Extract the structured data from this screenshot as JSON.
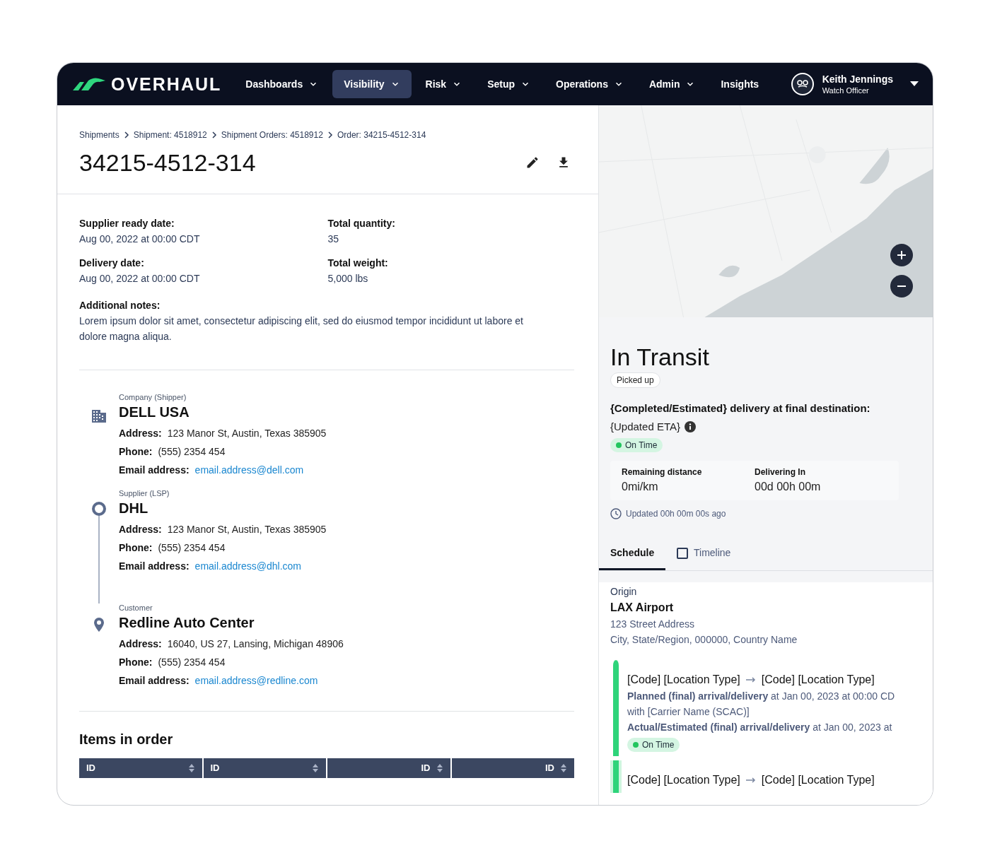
{
  "nav": {
    "logo": "OVERHAUL",
    "items": [
      {
        "label": "Dashboards",
        "selected": false,
        "dropdown": true
      },
      {
        "label": "Visibility",
        "selected": true,
        "dropdown": true
      },
      {
        "label": "Risk",
        "selected": false,
        "dropdown": true
      },
      {
        "label": "Setup",
        "selected": false,
        "dropdown": true
      },
      {
        "label": "Operations",
        "selected": false,
        "dropdown": true
      },
      {
        "label": "Admin",
        "selected": false,
        "dropdown": true
      },
      {
        "label": "Insights",
        "selected": false,
        "dropdown": false
      }
    ],
    "user": {
      "name": "Keith Jennings",
      "role": "Watch Officer"
    }
  },
  "breadcrumbs": [
    "Shipments",
    "Shipment: 4518912",
    "Shipment Orders: 4518912",
    "Order: 34215-4512-314"
  ],
  "title": "34215-4512-314",
  "fields": [
    {
      "label": "Supplier ready date:",
      "value": "Aug 00, 2022 at 00:00 CDT"
    },
    {
      "label": "Total quantity:",
      "value": "35"
    },
    {
      "label": "Delivery date:",
      "value": "Aug 00, 2022 at 00:00 CDT"
    },
    {
      "label": "Total weight:",
      "value": "5,000 lbs"
    }
  ],
  "notes": {
    "label": "Additional notes:",
    "text": "Lorem ipsum dolor sit amet, consectetur adipiscing elit, sed do eiusmod tempor incididunt ut labore et dolore magna aliqua."
  },
  "parties": [
    {
      "kind": "company",
      "category": "Company (Shipper)",
      "name": "DELL USA",
      "rows": [
        {
          "label": "Address:",
          "value": "123 Manor St, Austin, Texas 385905",
          "kind": "text"
        },
        {
          "label": "Phone:",
          "value": "(555) 2354 454",
          "kind": "text"
        },
        {
          "label": "Email address:",
          "value": "email.address@dell.com",
          "kind": "link"
        }
      ]
    },
    {
      "kind": "origin",
      "category": "Supplier (LSP)",
      "name": "DHL",
      "rows": [
        {
          "label": "Address:",
          "value": "123 Manor St, Austin, Texas 385905",
          "kind": "text"
        },
        {
          "label": "Phone:",
          "value": "(555) 2354 454",
          "kind": "text"
        },
        {
          "label": "Email address:",
          "value": "email.address@dhl.com",
          "kind": "link"
        }
      ]
    },
    {
      "kind": "destination",
      "category": "Customer",
      "name": "Redline Auto Center",
      "rows": [
        {
          "label": "Address:",
          "value": "16040, US 27, Lansing, Michigan 48906",
          "kind": "text"
        },
        {
          "label": "Phone:",
          "value": "(555) 2354 454",
          "kind": "text"
        },
        {
          "label": "Email address:",
          "value": "email.address@redline.com",
          "kind": "link"
        }
      ]
    }
  ],
  "items": {
    "title": "Items in order",
    "columns": [
      {
        "label": "ID"
      },
      {
        "label": "ID"
      },
      {
        "label": "ID"
      },
      {
        "label": "ID"
      }
    ]
  },
  "status": {
    "title": "In Transit",
    "badge": "Picked up",
    "eta_label": "{Completed/Estimated} delivery at final destination:",
    "eta_value": "{Updated ETA}",
    "state": {
      "label": "On Time",
      "color": "#22c55e"
    },
    "metrics": [
      {
        "label": "Remaining distance",
        "value": "0mi/km"
      },
      {
        "label": "Delivering In",
        "value": "00d 00h 00m"
      }
    ],
    "updated": "Updated 00h 00m 00s ago"
  },
  "tabs": [
    {
      "label": "Schedule",
      "selected": true
    },
    {
      "label": "Timeline",
      "selected": false
    }
  ],
  "origin": {
    "label": "Origin",
    "name": "LAX Airport",
    "lines": [
      "123 Street Address",
      "City, State/Region, 000000, Country Name"
    ]
  },
  "legs": [
    {
      "from": "[Code] [Location Type]",
      "to": "[Code] [Location Type]",
      "highlighted": false,
      "planned": "**Planned (final) arrival/delivery** at Jan 00, 2023 at 00:00 CD",
      "carrier": "with [Carrier Name (SCAC)]",
      "actual": "**Actual/Estimated (final) arrival/delivery** at Jan 00, 2023 at",
      "state": {
        "label": "On Time",
        "color": "#22c55e"
      }
    },
    {
      "from": "[Code] [Location Type]",
      "to": "[Code] [Location Type]",
      "highlighted": true
    }
  ]
}
